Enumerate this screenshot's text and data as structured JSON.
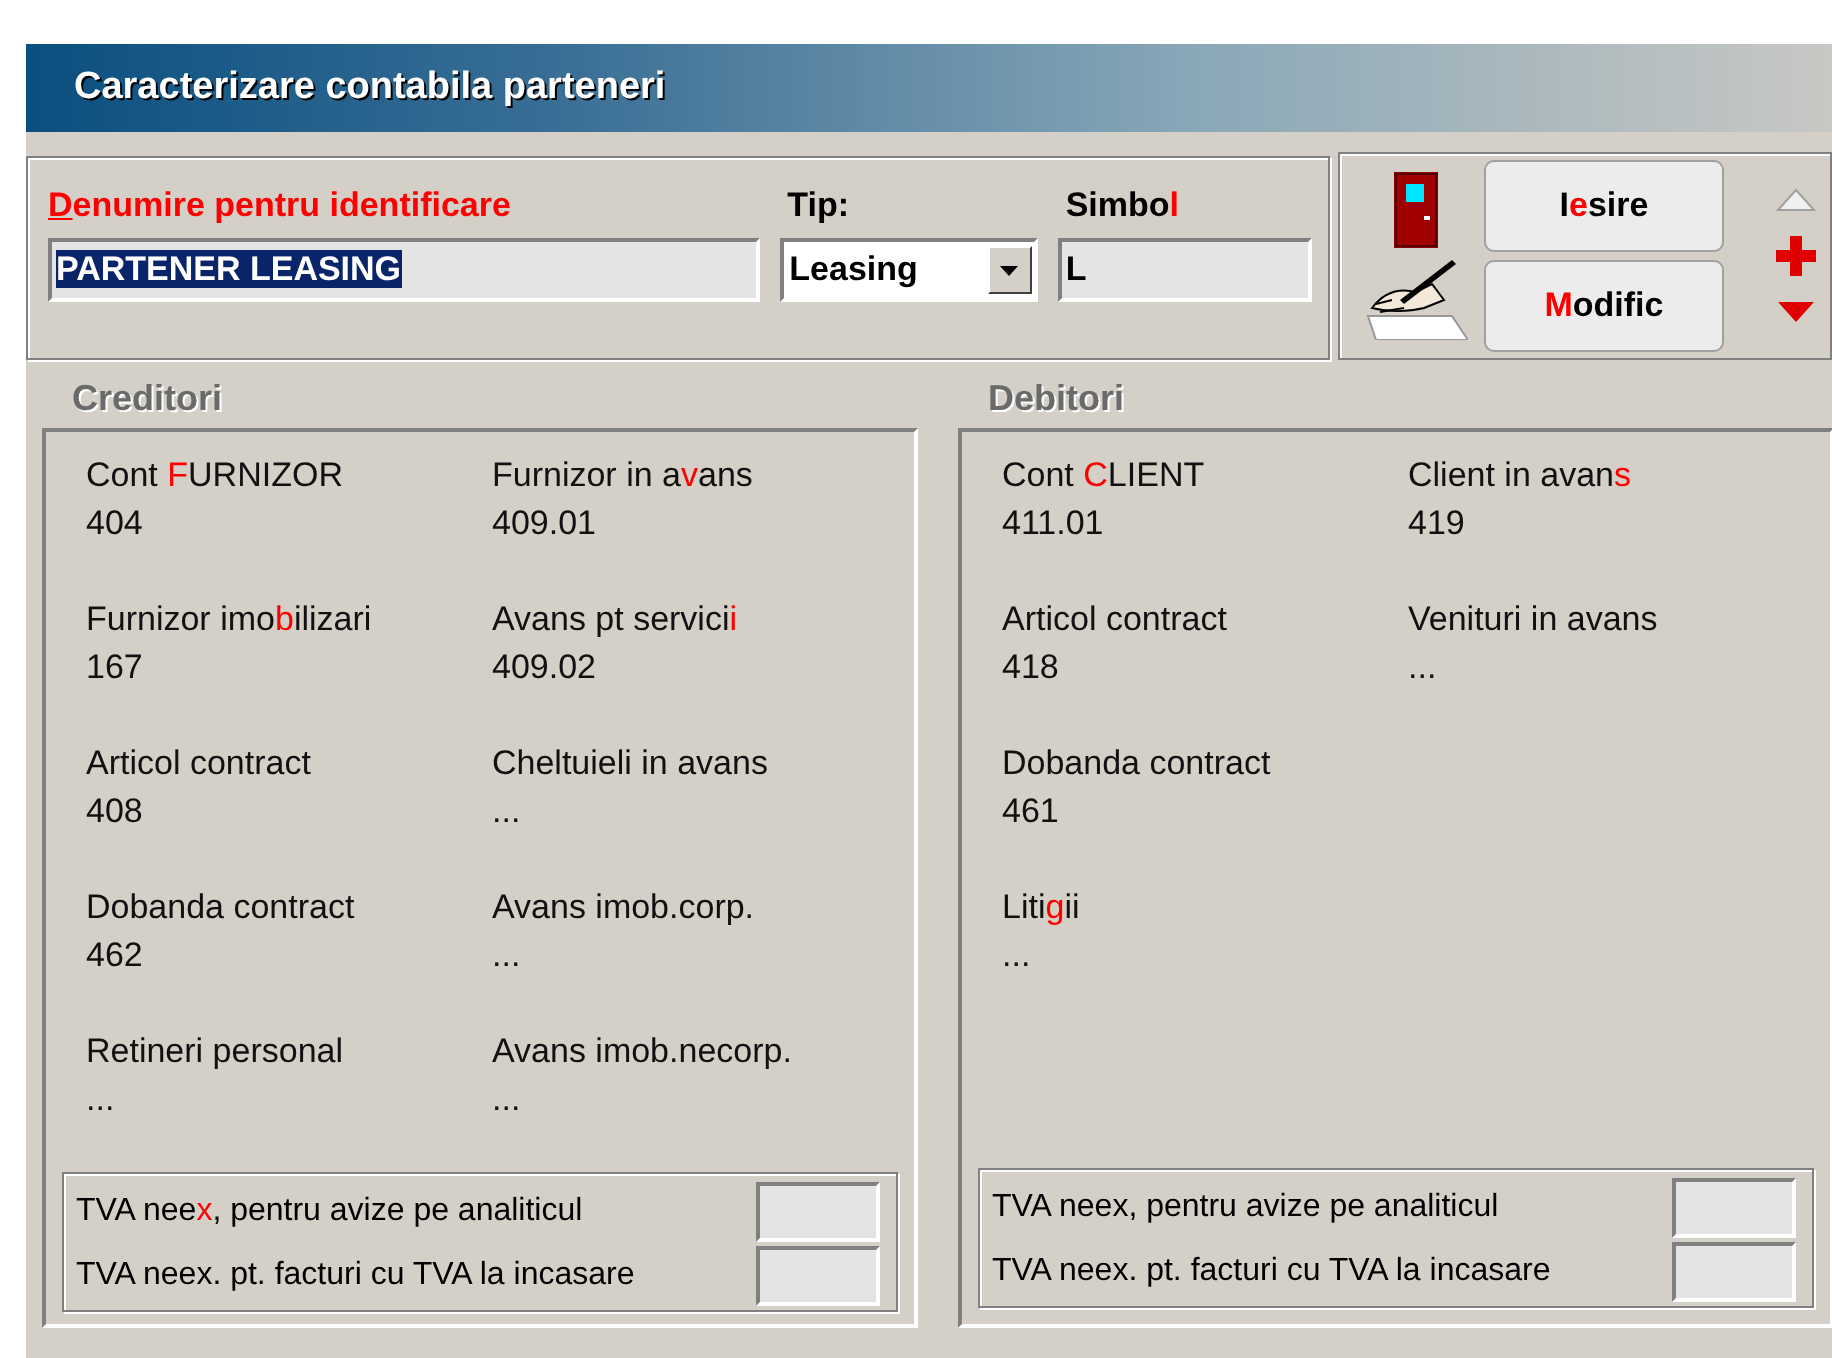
{
  "window": {
    "title": "Caracterizare contabila parteneri"
  },
  "header": {
    "name_label": {
      "emphasis": true,
      "key": "D",
      "post": "enumire pentru identificare"
    },
    "name_field": {
      "value": "PARTENER LEASING",
      "text_selected": true
    },
    "type_label": "Tip:",
    "type_select": {
      "value": "Leasing"
    },
    "symbol_label": {
      "emphasis": false,
      "pre": "Simbo",
      "key": "l"
    },
    "symbol_field": {
      "value": "L"
    }
  },
  "buttons": [
    {
      "pre": "I",
      "key": "e",
      "post": "sire"
    },
    {
      "key": "M",
      "post": "odific"
    }
  ],
  "nav": [
    {
      "kind": "up",
      "disabled": true
    },
    {
      "kind": "add",
      "disabled": false
    },
    {
      "kind": "down",
      "disabled": false
    }
  ],
  "panels": [
    {
      "title": "Creditori",
      "columns": [
        [
          {
            "label": {
              "pre": "Cont ",
              "key": "F",
              "post": "URNIZOR"
            },
            "value": "404"
          },
          {
            "label": {
              "pre": "Furnizor imo",
              "key": "b",
              "post": "ilizari"
            },
            "value": "167"
          },
          {
            "label": {
              "pre": "Articol contract"
            },
            "value": "408"
          },
          {
            "label": {
              "pre": "Dobanda contract"
            },
            "value": "462"
          },
          {
            "label": {
              "pre": "Retineri personal"
            },
            "value": "..."
          }
        ],
        [
          {
            "label": {
              "pre": "Furnizor in a",
              "key": "v",
              "post": "ans"
            },
            "value": "409.01"
          },
          {
            "label": {
              "pre": "Avans pt servici",
              "key": "i"
            },
            "value": "409.02"
          },
          {
            "label": {
              "pre": "Cheltuieli in avans"
            },
            "value": "..."
          },
          {
            "label": {
              "pre": "Avans imob.corp."
            },
            "value": "..."
          },
          {
            "label": {
              "pre": "Avans imob.necorp."
            },
            "value": "..."
          }
        ]
      ],
      "vat_rows": [
        {
          "pre": "TVA nee",
          "key": "x",
          "post": ", pentru avize pe analiticul"
        },
        {
          "pre": "TVA neex. pt. facturi cu TVA la incasare"
        }
      ]
    },
    {
      "title": "Debitori",
      "columns": [
        [
          {
            "label": {
              "pre": "Cont ",
              "key": "C",
              "post": "LIENT"
            },
            "value": "411.01"
          },
          {
            "label": {
              "pre": "Articol contract"
            },
            "value": "418"
          },
          {
            "label": {
              "pre": "Dobanda contract"
            },
            "value": "461"
          },
          {
            "label": {
              "pre": "Liti",
              "key": "g",
              "post": "ii"
            },
            "value": "..."
          }
        ],
        [
          {
            "label": {
              "pre": "Client in avan",
              "key": "s"
            },
            "value": "419"
          },
          {
            "label": {
              "pre": "Venituri in avans"
            },
            "value": "..."
          }
        ]
      ],
      "vat_rows": [
        {
          "pre": "TVA neex, pentru avize pe analiticul"
        },
        {
          "pre": "TVA neex. pt. facturi cu TVA la incasare"
        }
      ]
    }
  ]
}
